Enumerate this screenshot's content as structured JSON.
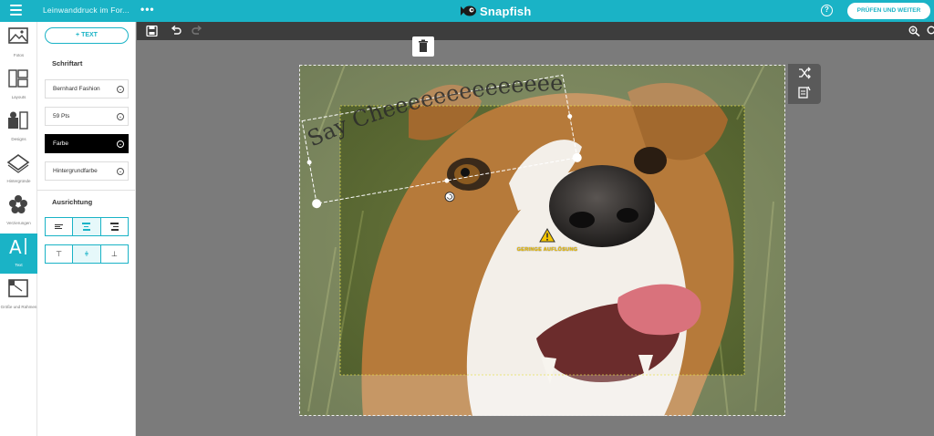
{
  "header": {
    "document_title": "Leinwanddruck im For...",
    "logo_text": "Snapfish",
    "primary_button": "PRÜFEN UND WEITER",
    "help_icon": "question-circle-icon",
    "menu_icon": "hamburger-icon"
  },
  "rail": {
    "items": [
      {
        "label": "Fotos",
        "icon": "photos-icon"
      },
      {
        "label": "Layouts",
        "icon": "layouts-icon"
      },
      {
        "label": "Designs",
        "icon": "designs-icon"
      },
      {
        "label": "Hintergründe",
        "icon": "backgrounds-icon"
      },
      {
        "label": "Verzierungen",
        "icon": "embellishments-icon"
      },
      {
        "label": "Text",
        "icon": "text-icon"
      },
      {
        "label": "Größe und Rahmen",
        "icon": "size-frame-icon"
      }
    ],
    "active": "Text"
  },
  "panel": {
    "add_text_label": "+ TEXT",
    "font_heading": "Schriftart",
    "font_family": "Bernhard Fashion",
    "font_size": "59 Pts",
    "color_label": "Farbe",
    "background_color_label": "Hintergrundfarbe",
    "alignment_heading": "Ausrichtung"
  },
  "canvas": {
    "text_content": "Say Cheeeeeeeeeeeeeeese",
    "warning_label": "GERINGE AUFLÖSUNG"
  },
  "colors": {
    "accent": "#1ab3c6",
    "toolbar": "#3d3d3d",
    "warning": "#f5c400"
  }
}
